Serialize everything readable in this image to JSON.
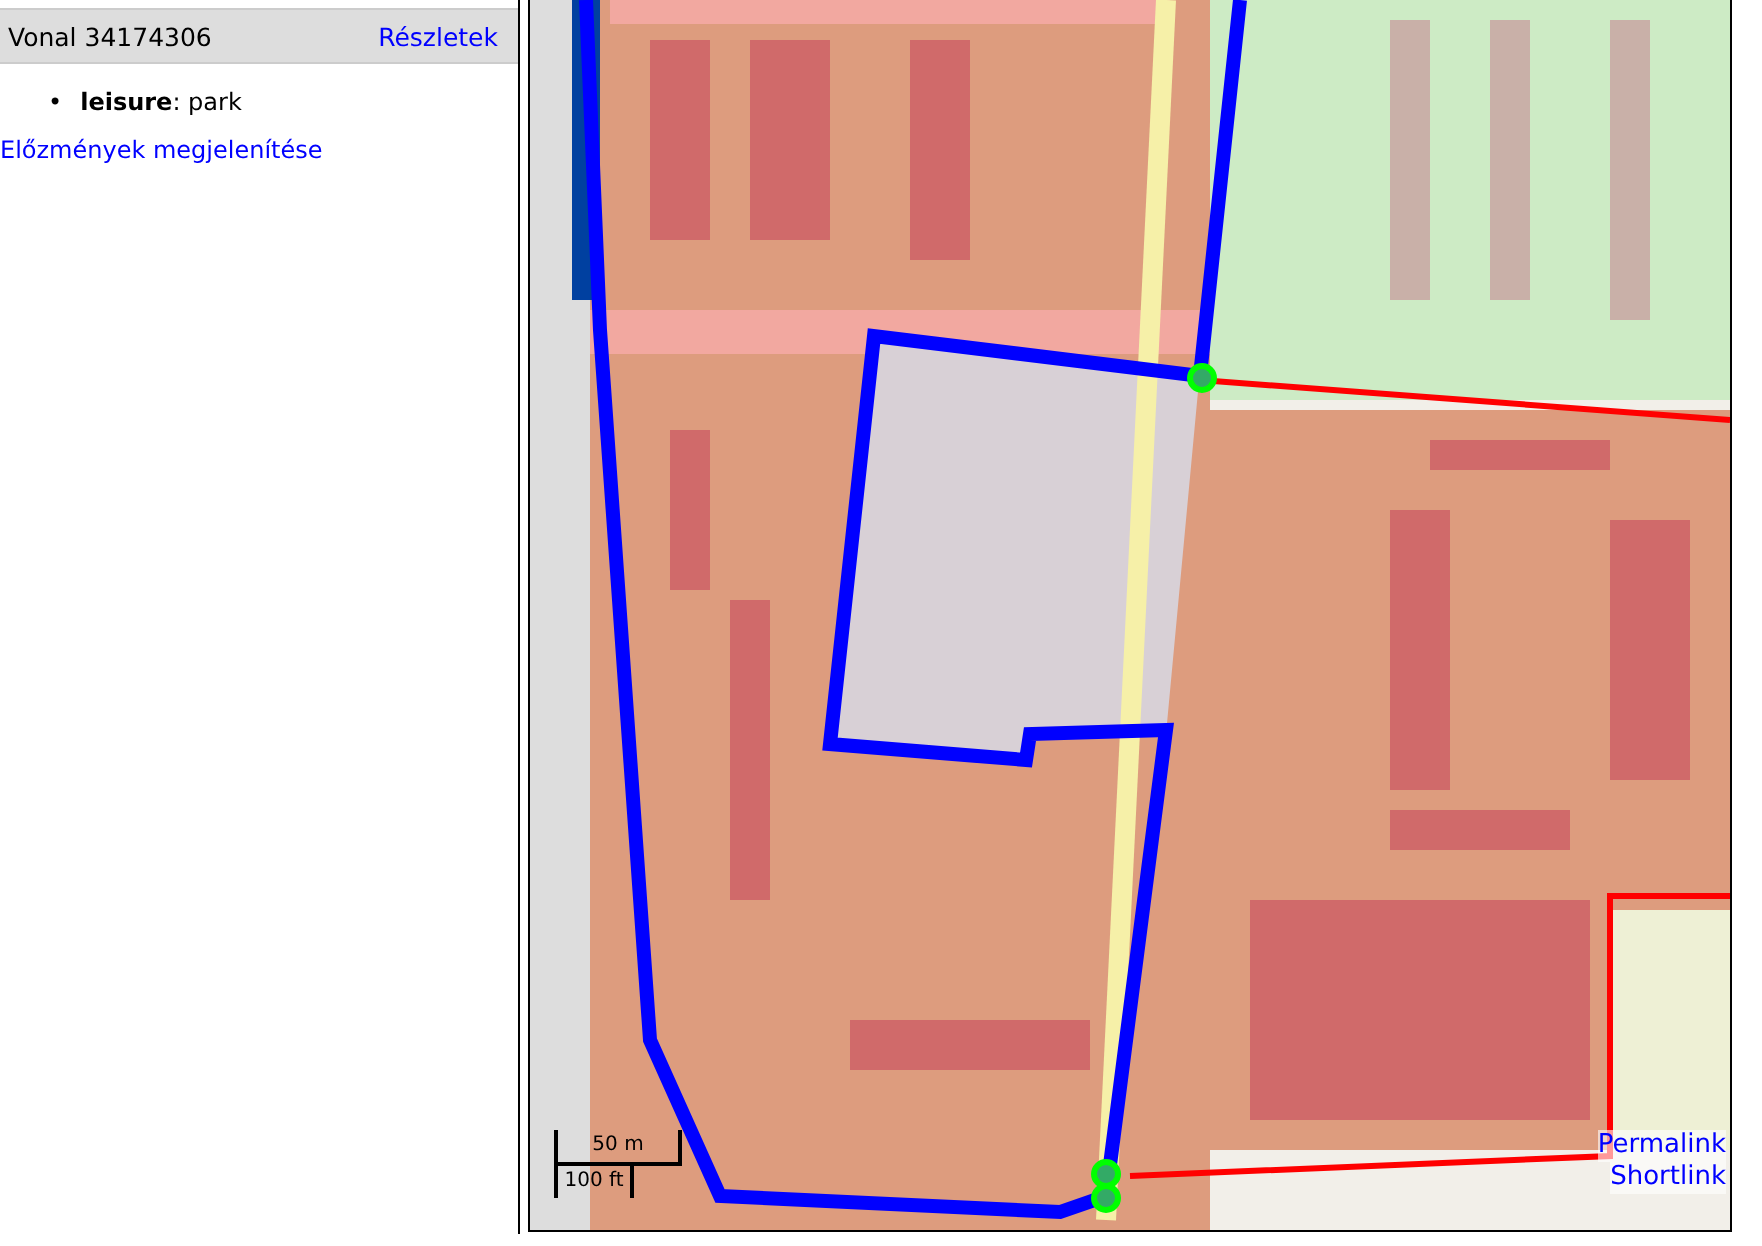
{
  "sidebar": {
    "header": {
      "title": "Vonal 34174306",
      "link": "Részletek"
    },
    "tags": [
      {
        "marker": "•",
        "text": "**leisure**: park"
      }
    ],
    "history_link": "Előzmények megjelenítése"
  },
  "map": {
    "scale": {
      "metric": "50 m",
      "imperial": "100 ft"
    },
    "links": [
      "Permalink",
      "Shortlink"
    ]
  }
}
